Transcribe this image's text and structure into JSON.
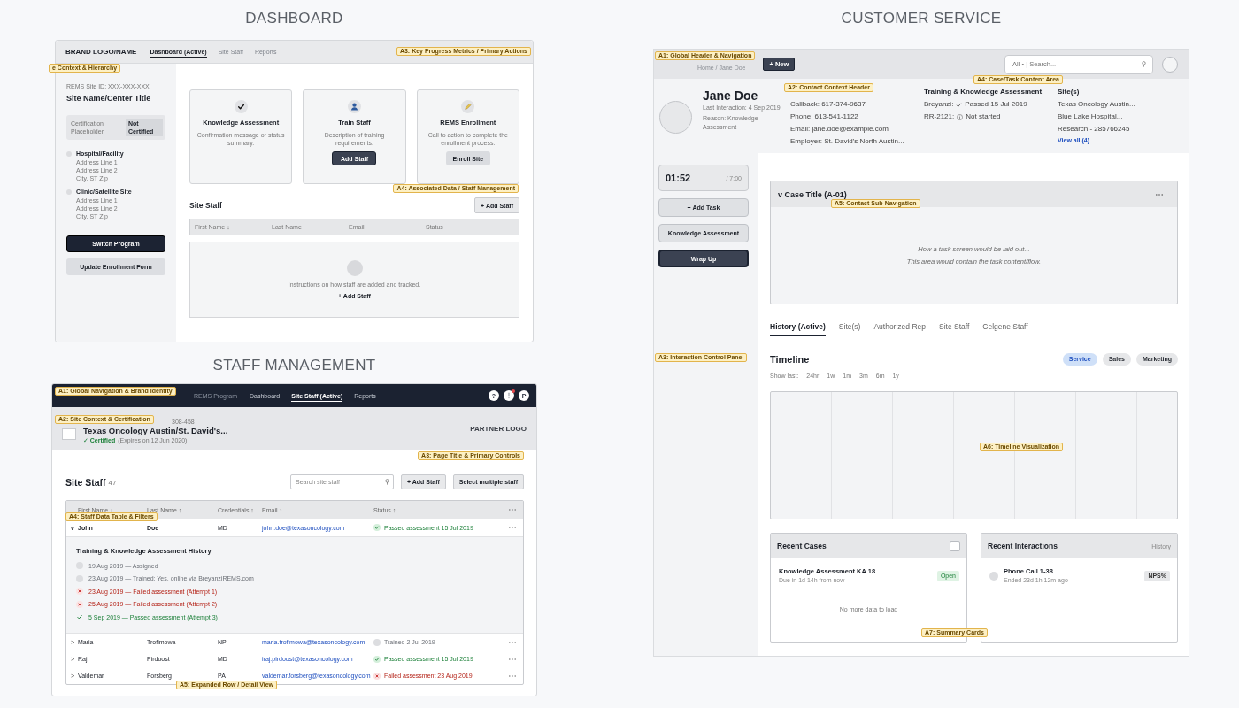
{
  "dashboard": {
    "heading": "DASHBOARD",
    "nav": {
      "brand": "BRAND LOGO/NAME",
      "tabs": [
        {
          "label": "Dashboard (Active)",
          "selected": true
        },
        {
          "label": "Site Staff",
          "selected": false
        },
        {
          "label": "Reports",
          "selected": false
        }
      ]
    },
    "sidebar": {
      "site_id": "REMS Site ID: XXX-XXX-XXX",
      "site_name": "Site Name/Center Title",
      "certification": {
        "label": "Certification Placeholder",
        "badge": "Not Certified"
      },
      "locations": [
        {
          "name": "Hospital/Facility",
          "lines": [
            "Address Line 1",
            "Address Line 2",
            "City, ST Zip"
          ]
        },
        {
          "name": "Clinic/Satellite Site",
          "lines": [
            "Address Line 1",
            "Address Line 2",
            "City, ST Zip"
          ]
        }
      ],
      "buttons": [
        {
          "label": "Switch Program",
          "kind": "primary"
        },
        {
          "label": "Update Enrollment Form",
          "kind": "secondary"
        }
      ]
    },
    "cards": [
      {
        "title": "Knowledge Assessment",
        "description": "Confirmation message or status summary."
      },
      {
        "title": "Train Staff",
        "description": "Description of training requirements.",
        "button": {
          "label": "Add Staff",
          "kind": "primary"
        }
      },
      {
        "title": "REMS Enrollment",
        "description": "Call to action to complete the enrollment process.",
        "button": {
          "label": "Enroll Site",
          "kind": "secondary"
        }
      }
    ],
    "staff": {
      "title": "Site Staff",
      "add_button": "+ Add Staff",
      "columns": [
        "First Name ↓",
        "Last Name",
        "Email",
        "Status"
      ],
      "empty_state": {
        "message": "Instructions on how staff are added and tracked.",
        "action": "+ Add Staff"
      }
    },
    "annotations": [
      {
        "label": "e Context & Hierarchy"
      },
      {
        "label": "A3: Key Progress Metrics / Primary Actions"
      },
      {
        "label": "A4: Associated Data / Staff Management"
      }
    ]
  },
  "staff_management": {
    "heading": "STAFF MANAGEMENT",
    "nav": {
      "program": "REMS Program",
      "tabs": [
        {
          "label": "Dashboard",
          "selected": false
        },
        {
          "label": "Site Staff (Active)",
          "selected": true
        },
        {
          "label": "Reports",
          "selected": false
        }
      ],
      "help": "?",
      "alert_dot": true,
      "profile": "P"
    },
    "site": {
      "id_fragment": "308-458",
      "name": "Texas Oncology Austin/St. David's...",
      "certified": "✓ Certified",
      "expiry": "(Expires on 12 Jun 2020)",
      "partner_logo": "PARTNER LOGO"
    },
    "title": "Site Staff",
    "count": "47",
    "search": {
      "placeholder": "Search site staff"
    },
    "buttons": [
      "+ Add Staff",
      "Select multiple staff"
    ],
    "columns": [
      "First Name ↓",
      "Last Name ↑",
      "Credentials ↕",
      "Email ↕",
      "Status ↕"
    ],
    "rows": [
      {
        "toggle": "v",
        "first_name": "John",
        "last_name": "Doe",
        "credentials": "MD",
        "email": "john.doe@texasoncology.com",
        "status": "Passed assessment 15 Jul 2019",
        "kind": "passed",
        "expanded": true,
        "history": {
          "title": "Training & Knowledge Assessment History",
          "events": [
            {
              "text": "19 Aug 2019 — Assigned",
              "kind": "pending"
            },
            {
              "text": "23 Aug 2019 — Trained: Yes, online via BreyanziREMS.com",
              "kind": "pending"
            },
            {
              "text": "23 Aug 2019 — Failed assessment (Attempt 1)",
              "kind": "failed"
            },
            {
              "text": "25 Aug 2019 — Failed assessment (Attempt 2)",
              "kind": "failed"
            },
            {
              "text": "5 Sep 2019 — Passed assessment (Attempt 3)",
              "kind": "passed"
            }
          ]
        }
      },
      {
        "toggle": ">",
        "first_name": "Maria",
        "last_name": "Trofimowa",
        "credentials": "NP",
        "email": "maria.trofimowa@texasoncology.com",
        "status": "Trained 2 Jul 2019",
        "kind": "trained",
        "expanded": false
      },
      {
        "toggle": ">",
        "first_name": "Raj",
        "last_name": "Pirdoost",
        "credentials": "MD",
        "email": "iraj.pirdoost@texasoncology.com",
        "status": "Passed assessment 15 Jul 2019",
        "kind": "passed",
        "expanded": false
      },
      {
        "toggle": ">",
        "first_name": "Valdemar",
        "last_name": "Forsberg",
        "credentials": "PA",
        "email": "valdemar.forsberg@texasoncology.com",
        "status": "Failed assessment 23 Aug 2019",
        "kind": "failed",
        "expanded": false
      }
    ],
    "annotations": [
      {
        "label": "A1: Global Navigation & Brand Identity"
      },
      {
        "label": "A2: Site Context & Certification"
      },
      {
        "label": "A3: Page Title & Primary Controls"
      },
      {
        "label": "A4: Staff Data Table & Filters"
      },
      {
        "label": "A5: Expanded Row / Detail View"
      }
    ]
  },
  "customer_service": {
    "heading": "CUSTOMER SERVICE",
    "header": {
      "breadcrumb": "Home / Jane Doe",
      "new_button": "+ New",
      "search": {
        "placeholder": "All • | Search..."
      }
    },
    "contact": {
      "name": "Jane Doe",
      "last_interaction": "Last Interaction: 4 Sep 2019",
      "reason": "Reason: Knowledge Assessment",
      "contact_info": [
        "Callback: 617-374-9637",
        "Phone: 613-541-1122",
        "Email: jane.doe@example.com",
        "Employer: St. David's North Austin..."
      ],
      "training": {
        "title": "Training & Knowledge Assessment",
        "items": [
          {
            "label": "Breyanzi:",
            "status": "Passed 15 Jul 2019",
            "kind": "passed"
          },
          {
            "label": "RR-2121:",
            "status": "Not started",
            "kind": "info"
          }
        ]
      },
      "sites": {
        "title": "Site(s)",
        "items": [
          "Texas Oncology Austin...",
          "Blue Lake Hospital...",
          "Research - 285766245"
        ],
        "link": "View all (4)"
      }
    },
    "controls": {
      "timer": "01:52",
      "limit": "/ 7:00",
      "buttons": [
        {
          "label": "+ Add Task",
          "kind": "secondary"
        },
        {
          "label": "Knowledge Assessment",
          "kind": "secondary"
        },
        {
          "label": "Wrap Up",
          "kind": "primary"
        }
      ]
    },
    "case": {
      "title": "v Case Title (A-01)",
      "placeholder_lines": [
        "How a task screen would be laid out...",
        "This area would contain the task content/flow."
      ]
    },
    "tabs": [
      {
        "label": "History (Active)",
        "selected": true
      },
      {
        "label": "Site(s)",
        "selected": false
      },
      {
        "label": "Authorized Rep",
        "selected": false
      },
      {
        "label": "Site Staff",
        "selected": false
      },
      {
        "label": "Celgene Staff",
        "selected": false
      }
    ],
    "timeline": {
      "title": "Timeline",
      "filters": [
        {
          "label": "Service",
          "selected": true
        },
        {
          "label": "Sales",
          "selected": false
        },
        {
          "label": "Marketing",
          "selected": false
        }
      ],
      "range_label": "Show last:",
      "ranges": [
        "24hr",
        "1w",
        "1m",
        "3m",
        "6m",
        "1y"
      ]
    },
    "recent_cases": {
      "title": "Recent Cases",
      "checked": false,
      "items": [
        {
          "title": "Knowledge Assessment KA 18",
          "subtitle": "Due in 1d 14h from now",
          "badge": "Open"
        }
      ],
      "footer": "No more data to load"
    },
    "recent_interactions": {
      "title": "Recent Interactions",
      "link": "History",
      "items": [
        {
          "title": "Phone Call 1-38",
          "subtitle": "Ended 23d 1h 12m ago",
          "badge": "NPS%"
        }
      ]
    },
    "annotations": [
      {
        "label": "A1: Global Header & Navigation"
      },
      {
        "label": "A2: Contact Context Header"
      },
      {
        "label": "A3: Interaction Control Panel"
      },
      {
        "label": "A4: Case/Task Content Area"
      },
      {
        "label": "A5: Contact Sub-Navigation"
      },
      {
        "label": "A6: Timeline Visualization"
      },
      {
        "label": "A7: Summary Cards"
      }
    ]
  }
}
